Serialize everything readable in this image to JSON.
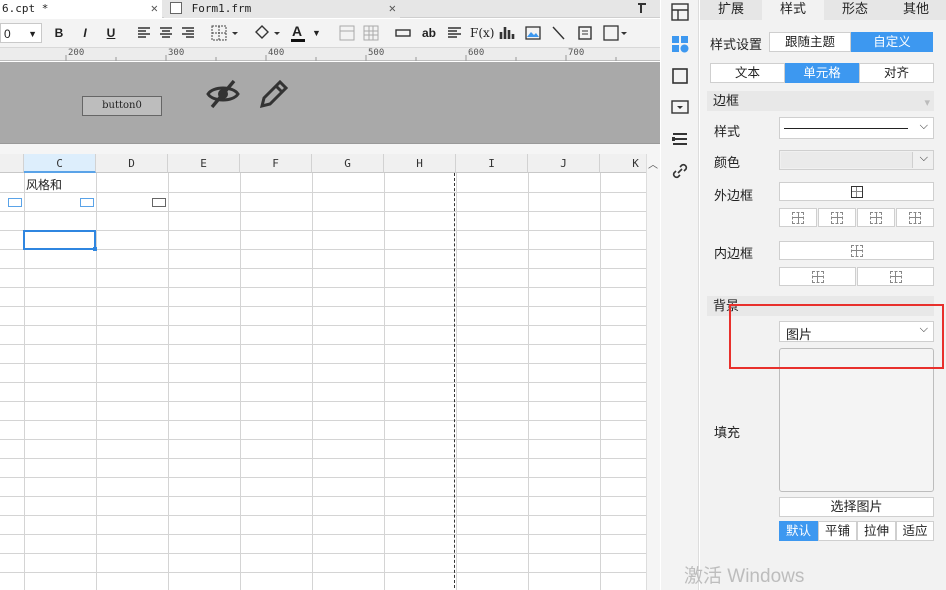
{
  "tabs": [
    {
      "title": "6.cpt *",
      "close": "✕"
    },
    {
      "title": "Form1.frm",
      "close": "✕"
    }
  ],
  "toolbar": {
    "font_size": "0",
    "bold": "B",
    "italic": "I",
    "underline": "U",
    "text_color": "A",
    "abbr": "ab",
    "formula": "F(x)"
  },
  "ruler": {
    "marks": [
      "200",
      "300",
      "400",
      "500",
      "600",
      "700"
    ]
  },
  "form": {
    "button_label": "button0"
  },
  "sheet": {
    "columns": [
      "C",
      "D",
      "E",
      "F",
      "G",
      "H",
      "I",
      "J",
      "K"
    ],
    "cell_c1": "风格和"
  },
  "panel": {
    "tabs": [
      "扩展",
      "样式",
      "形态",
      "其他"
    ],
    "active_tab": "样式",
    "style_setting_label": "样式设置",
    "style_modes": [
      "跟随主题",
      "自定义"
    ],
    "active_mode": "自定义",
    "sub_tabs": [
      "文本",
      "单元格",
      "对齐"
    ],
    "active_sub_tab": "单元格",
    "border_section": "边框",
    "style_label": "样式",
    "color_label": "颜色",
    "outer_border_label": "外边框",
    "inner_border_label": "内边框",
    "background_section": "背景",
    "background_type": "图片",
    "fill_label": "填充",
    "choose_image": "选择图片",
    "image_modes": [
      "默认",
      "平铺",
      "拉伸",
      "适应"
    ],
    "active_image_mode": "默认"
  },
  "watermark": "激活 Windows",
  "colors": {
    "accent": "#3d98f0",
    "highlight": "#e8302c"
  }
}
